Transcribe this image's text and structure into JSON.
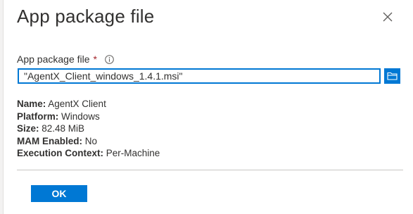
{
  "panel": {
    "title": "App package file"
  },
  "field": {
    "label": "App package file",
    "required_mark": "*",
    "value": "\"AgentX_Client_windows_1.4.1.msi\""
  },
  "details": [
    {
      "key": "Name:",
      "value": " AgentX Client"
    },
    {
      "key": "Platform:",
      "value": " Windows"
    },
    {
      "key": "Size:",
      "value": " 82.48 MiB"
    },
    {
      "key": "MAM Enabled:",
      "value": " No"
    },
    {
      "key": "Execution Context:",
      "value": " Per-Machine"
    }
  ],
  "footer": {
    "ok_label": "OK"
  },
  "colors": {
    "accent": "#0078d4",
    "required": "#a4262c"
  },
  "icons": {
    "close": "close-icon",
    "info": "info-icon",
    "browse": "folder-icon"
  }
}
